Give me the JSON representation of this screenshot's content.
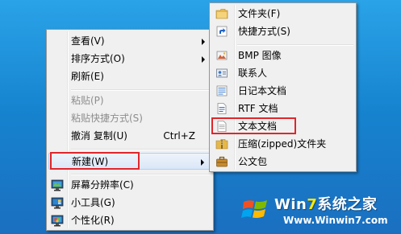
{
  "context_menu": {
    "items": [
      {
        "label": "查看(V)",
        "has_submenu": true
      },
      {
        "label": "排序方式(O)",
        "has_submenu": true
      },
      {
        "label": "刷新(E)"
      },
      {
        "label": "粘贴(P)",
        "disabled": true
      },
      {
        "label": "粘贴快捷方式(S)",
        "disabled": true
      },
      {
        "label": "撤消 复制(U)",
        "shortcut": "Ctrl+Z"
      },
      {
        "label": "新建(W)",
        "has_submenu": true,
        "highlighted": true
      },
      {
        "label": "屏幕分辨率(C)",
        "icon": "display-resolution-icon"
      },
      {
        "label": "小工具(G)",
        "icon": "gadgets-icon"
      },
      {
        "label": "个性化(R)",
        "icon": "personalize-icon"
      }
    ]
  },
  "new_submenu": {
    "items": [
      {
        "label": "文件夹(F)",
        "icon": "folder-icon"
      },
      {
        "label": "快捷方式(S)",
        "icon": "shortcut-icon"
      },
      {
        "label": "BMP 图像",
        "icon": "bmp-image-icon"
      },
      {
        "label": "联系人",
        "icon": "contact-icon"
      },
      {
        "label": "日记本文档",
        "icon": "journal-icon"
      },
      {
        "label": "RTF 文档",
        "icon": "rtf-document-icon"
      },
      {
        "label": "文本文档",
        "icon": "text-document-icon",
        "highlighted": true
      },
      {
        "label": "压缩(zipped)文件夹",
        "icon": "zip-folder-icon"
      },
      {
        "label": "公文包",
        "icon": "briefcase-icon"
      }
    ]
  },
  "watermark": {
    "title_prefix": "Win",
    "title_seven": "7",
    "title_suffix": "系统之家",
    "url": "Www.Winwin7.com"
  },
  "colors": {
    "highlight_box": "#e0262b",
    "desktop": "#1683cf"
  }
}
